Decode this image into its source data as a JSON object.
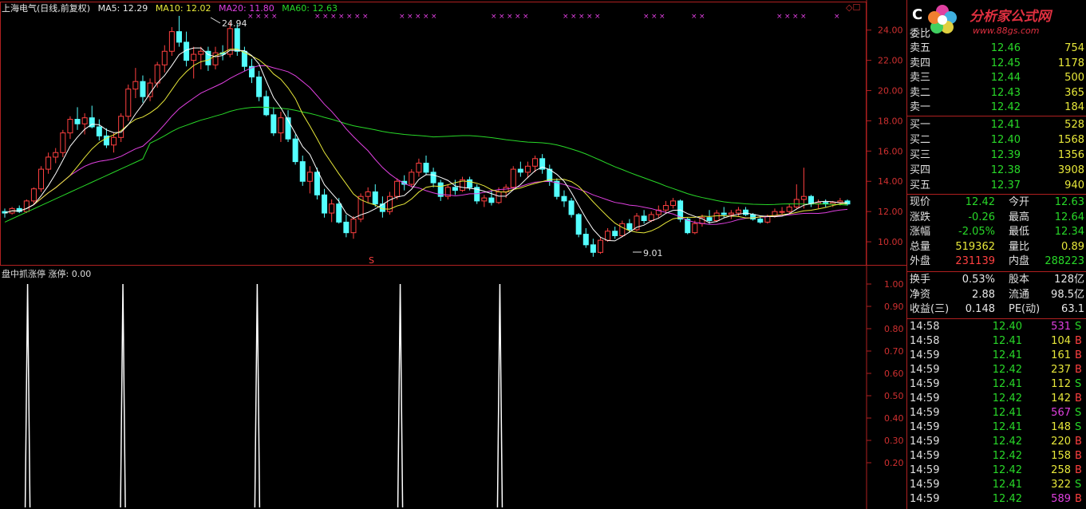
{
  "header": {
    "stock_name": "上海电气(日线,前复权)",
    "ma5": "MA5: 12.29",
    "ma10": "MA10: 12.02",
    "ma20": "MA20: 11.80",
    "ma60": "MA60: 12.63"
  },
  "indicator_header": "盘中抓涨停 涨停: 0.00",
  "price_axis": [
    "24.00",
    "22.00",
    "20.00",
    "18.00",
    "16.00",
    "14.00",
    "12.00",
    "10.00"
  ],
  "indicator_axis": [
    "1.00",
    "0.90",
    "0.80",
    "0.70",
    "0.60",
    "0.50",
    "0.40",
    "0.30",
    "0.20"
  ],
  "annotations": {
    "high": "24.94",
    "low": "9.01",
    "marker": "S"
  },
  "colors": {
    "ma5": "#ffffff",
    "ma10": "#e8e83a",
    "ma20": "#e040e0",
    "ma60": "#28d828",
    "up": "#ff4040",
    "down": "#54ffff",
    "grid": "#b02020",
    "signal": "#e040e0"
  },
  "chart_data": {
    "type": "candlestick",
    "price_range": [
      9.0,
      25.2
    ],
    "candles": [
      [
        12.0,
        12.2,
        11.6,
        11.9
      ],
      [
        11.9,
        12.3,
        11.8,
        12.2
      ],
      [
        12.2,
        12.4,
        11.9,
        12.0
      ],
      [
        12.0,
        12.8,
        11.9,
        12.7
      ],
      [
        12.7,
        13.6,
        12.5,
        13.5
      ],
      [
        13.5,
        15.0,
        13.3,
        14.8
      ],
      [
        14.8,
        15.9,
        14.5,
        15.6
      ],
      [
        15.6,
        16.2,
        15.2,
        15.9
      ],
      [
        15.9,
        17.4,
        15.6,
        17.2
      ],
      [
        17.2,
        18.3,
        16.8,
        18.1
      ],
      [
        18.1,
        18.9,
        17.4,
        17.8
      ],
      [
        17.8,
        18.5,
        17.1,
        18.2
      ],
      [
        18.2,
        19.0,
        17.5,
        17.6
      ],
      [
        17.6,
        18.1,
        16.7,
        17.0
      ],
      [
        17.0,
        17.5,
        16.2,
        16.4
      ],
      [
        16.4,
        17.2,
        15.9,
        16.9
      ],
      [
        16.9,
        18.5,
        16.6,
        18.3
      ],
      [
        18.3,
        20.4,
        18.0,
        20.1
      ],
      [
        20.1,
        21.5,
        19.5,
        20.6
      ],
      [
        20.6,
        21.0,
        19.2,
        19.6
      ],
      [
        19.6,
        20.8,
        19.3,
        20.5
      ],
      [
        20.5,
        21.9,
        20.2,
        21.7
      ],
      [
        21.7,
        23.0,
        21.2,
        22.6
      ],
      [
        22.6,
        24.2,
        22.3,
        23.9
      ],
      [
        23.9,
        24.94,
        22.9,
        23.2
      ],
      [
        23.2,
        23.9,
        21.6,
        22.0
      ],
      [
        22.0,
        22.9,
        20.8,
        22.4
      ],
      [
        22.4,
        22.9,
        21.4,
        22.6
      ],
      [
        22.6,
        22.9,
        21.3,
        21.7
      ],
      [
        21.7,
        22.9,
        21.4,
        22.5
      ],
      [
        22.5,
        23.0,
        22.0,
        22.4
      ],
      [
        22.4,
        24.5,
        22.2,
        24.1
      ],
      [
        24.1,
        24.4,
        22.3,
        22.6
      ],
      [
        22.6,
        22.9,
        21.3,
        21.6
      ],
      [
        21.6,
        22.1,
        20.5,
        20.9
      ],
      [
        20.9,
        21.3,
        19.3,
        19.6
      ],
      [
        19.6,
        20.0,
        18.3,
        18.4
      ],
      [
        18.4,
        18.9,
        17.0,
        17.2
      ],
      [
        17.2,
        18.6,
        16.6,
        18.2
      ],
      [
        18.2,
        18.7,
        16.6,
        16.8
      ],
      [
        16.8,
        17.1,
        15.1,
        15.3
      ],
      [
        15.3,
        15.7,
        13.7,
        14.0
      ],
      [
        14.0,
        15.0,
        13.2,
        14.6
      ],
      [
        14.6,
        14.9,
        12.8,
        13.1
      ],
      [
        13.1,
        13.5,
        11.6,
        11.9
      ],
      [
        11.9,
        12.8,
        11.3,
        12.5
      ],
      [
        12.5,
        12.9,
        11.2,
        11.3
      ],
      [
        11.3,
        11.8,
        10.3,
        10.6
      ],
      [
        10.6,
        11.7,
        10.2,
        11.5
      ],
      [
        11.5,
        13.2,
        11.3,
        13.0
      ],
      [
        13.0,
        13.6,
        12.6,
        13.3
      ],
      [
        13.3,
        13.8,
        12.3,
        12.5
      ],
      [
        12.5,
        13.0,
        11.6,
        12.0
      ],
      [
        12.0,
        13.3,
        11.8,
        13.0
      ],
      [
        13.0,
        14.2,
        12.8,
        14.0
      ],
      [
        14.0,
        14.4,
        13.4,
        13.8
      ],
      [
        13.8,
        14.8,
        13.6,
        14.6
      ],
      [
        14.6,
        15.5,
        14.3,
        15.2
      ],
      [
        15.2,
        15.7,
        14.4,
        14.6
      ],
      [
        14.6,
        14.9,
        13.6,
        13.9
      ],
      [
        13.9,
        14.1,
        12.7,
        13.0
      ],
      [
        13.0,
        13.8,
        12.8,
        13.6
      ],
      [
        13.6,
        14.1,
        13.1,
        13.4
      ],
      [
        13.4,
        14.3,
        13.3,
        14.1
      ],
      [
        14.1,
        14.3,
        13.4,
        13.6
      ],
      [
        13.6,
        13.8,
        12.5,
        12.7
      ],
      [
        12.7,
        13.1,
        12.3,
        12.9
      ],
      [
        12.9,
        13.4,
        12.4,
        12.6
      ],
      [
        12.6,
        13.6,
        12.5,
        13.3
      ],
      [
        13.3,
        13.8,
        12.9,
        13.6
      ],
      [
        13.6,
        15.0,
        13.4,
        14.8
      ],
      [
        14.8,
        15.3,
        14.3,
        14.6
      ],
      [
        14.6,
        15.3,
        14.2,
        15.0
      ],
      [
        15.0,
        15.7,
        14.6,
        15.5
      ],
      [
        15.5,
        15.8,
        14.5,
        14.8
      ],
      [
        14.8,
        15.1,
        13.7,
        14.0
      ],
      [
        14.0,
        14.2,
        12.8,
        13.0
      ],
      [
        13.0,
        13.4,
        12.3,
        12.7
      ],
      [
        12.7,
        12.9,
        11.6,
        11.8
      ],
      [
        11.8,
        11.9,
        10.3,
        10.5
      ],
      [
        10.5,
        10.9,
        9.6,
        9.8
      ],
      [
        9.8,
        10.2,
        9.01,
        9.3
      ],
      [
        9.3,
        10.3,
        9.2,
        10.1
      ],
      [
        10.1,
        10.9,
        10.0,
        10.7
      ],
      [
        10.7,
        11.0,
        10.2,
        10.4
      ],
      [
        10.4,
        11.4,
        10.3,
        11.2
      ],
      [
        11.2,
        11.5,
        10.6,
        10.8
      ],
      [
        10.8,
        11.9,
        10.7,
        11.7
      ],
      [
        11.7,
        12.1,
        11.2,
        11.4
      ],
      [
        11.4,
        12.0,
        11.3,
        11.8
      ],
      [
        11.8,
        12.4,
        11.6,
        12.1
      ],
      [
        12.1,
        12.7,
        11.9,
        12.4
      ],
      [
        12.4,
        12.9,
        12.2,
        12.7
      ],
      [
        12.7,
        12.8,
        11.3,
        11.5
      ],
      [
        11.5,
        11.6,
        10.5,
        10.6
      ],
      [
        10.6,
        11.4,
        10.5,
        11.2
      ],
      [
        11.2,
        11.8,
        11.0,
        11.6
      ],
      [
        11.6,
        12.1,
        11.2,
        11.4
      ],
      [
        11.4,
        12.1,
        11.3,
        11.9
      ],
      [
        11.9,
        12.3,
        11.6,
        11.8
      ],
      [
        11.8,
        12.1,
        11.5,
        11.9
      ],
      [
        11.9,
        12.3,
        11.7,
        12.1
      ],
      [
        12.1,
        12.3,
        11.7,
        11.8
      ],
      [
        11.8,
        11.9,
        11.4,
        11.5
      ],
      [
        11.5,
        11.7,
        11.2,
        11.3
      ],
      [
        11.3,
        11.8,
        11.2,
        11.7
      ],
      [
        11.7,
        12.2,
        11.6,
        12.0
      ],
      [
        12.0,
        12.3,
        11.8,
        12.0
      ],
      [
        12.0,
        12.5,
        11.9,
        12.3
      ],
      [
        12.3,
        13.8,
        12.2,
        12.8
      ],
      [
        12.8,
        14.9,
        12.2,
        13.0
      ],
      [
        13.0,
        13.1,
        12.3,
        12.5
      ],
      [
        12.5,
        12.8,
        12.2,
        12.6
      ],
      [
        12.6,
        12.8,
        12.3,
        12.5
      ],
      [
        12.5,
        12.7,
        12.3,
        12.6
      ],
      [
        12.6,
        12.9,
        12.4,
        12.7
      ],
      [
        12.7,
        12.8,
        12.4,
        12.5
      ]
    ],
    "signal_x_fraction": [
      0.03,
      0.14,
      0.295,
      0.46,
      0.575
    ],
    "signal_values": [
      1,
      1,
      1,
      1,
      1
    ]
  },
  "panel": {
    "logo_text": "分析家公式网",
    "logo_site": "www.88gs.com",
    "logo_letter": "C",
    "header_label": "委比",
    "sell_rows": [
      {
        "label": "卖五",
        "price": "12.46",
        "vol": "754"
      },
      {
        "label": "卖四",
        "price": "12.45",
        "vol": "1178"
      },
      {
        "label": "卖三",
        "price": "12.44",
        "vol": "500"
      },
      {
        "label": "卖二",
        "price": "12.43",
        "vol": "365"
      },
      {
        "label": "卖一",
        "price": "12.42",
        "vol": "184"
      }
    ],
    "buy_rows": [
      {
        "label": "买一",
        "price": "12.41",
        "vol": "528"
      },
      {
        "label": "买二",
        "price": "12.40",
        "vol": "1568"
      },
      {
        "label": "买三",
        "price": "12.39",
        "vol": "1356"
      },
      {
        "label": "买四",
        "price": "12.38",
        "vol": "3908"
      },
      {
        "label": "买五",
        "price": "12.37",
        "vol": "940"
      }
    ],
    "quote_rows": [
      {
        "l1": "现价",
        "v1": "12.42",
        "l2": "今开",
        "v2": "12.63"
      },
      {
        "l1": "涨跌",
        "v1": "-0.26",
        "l2": "最高",
        "v2": "12.64"
      },
      {
        "l1": "涨幅",
        "v1": "-2.05%",
        "l2": "最低",
        "v2": "12.34"
      },
      {
        "l1": "总量",
        "v1": "519362",
        "l2": "量比",
        "v2": "0.89"
      },
      {
        "l1": "外盘",
        "v1": "231139",
        "l2": "内盘",
        "v2": "288223"
      }
    ],
    "stat_rows": [
      {
        "l1": "换手",
        "v1": "0.53%",
        "l2": "股本",
        "v2": "128亿"
      },
      {
        "l1": "净资",
        "v1": "2.88",
        "l2": "流通",
        "v2": "98.5亿"
      },
      {
        "l1": "收益(三)",
        "v1": "0.148",
        "l2": "PE(动)",
        "v2": "63.1"
      }
    ],
    "trades": [
      {
        "time": "14:58",
        "price": "12.40",
        "vol": "531",
        "bs": "S"
      },
      {
        "time": "14:58",
        "price": "12.41",
        "vol": "104",
        "bs": "B"
      },
      {
        "time": "14:59",
        "price": "12.41",
        "vol": "161",
        "bs": "B"
      },
      {
        "time": "14:59",
        "price": "12.42",
        "vol": "237",
        "bs": "B"
      },
      {
        "time": "14:59",
        "price": "12.41",
        "vol": "112",
        "bs": "S"
      },
      {
        "time": "14:59",
        "price": "12.42",
        "vol": "142",
        "bs": "B"
      },
      {
        "time": "14:59",
        "price": "12.41",
        "vol": "567",
        "bs": "S"
      },
      {
        "time": "14:59",
        "price": "12.41",
        "vol": "148",
        "bs": "S"
      },
      {
        "time": "14:59",
        "price": "12.42",
        "vol": "220",
        "bs": "B"
      },
      {
        "time": "14:59",
        "price": "12.42",
        "vol": "158",
        "bs": "B"
      },
      {
        "time": "14:59",
        "price": "12.42",
        "vol": "258",
        "bs": "B"
      },
      {
        "time": "14:59",
        "price": "12.41",
        "vol": "322",
        "bs": "S"
      },
      {
        "time": "14:59",
        "price": "12.42",
        "vol": "589",
        "bs": "B"
      }
    ]
  }
}
